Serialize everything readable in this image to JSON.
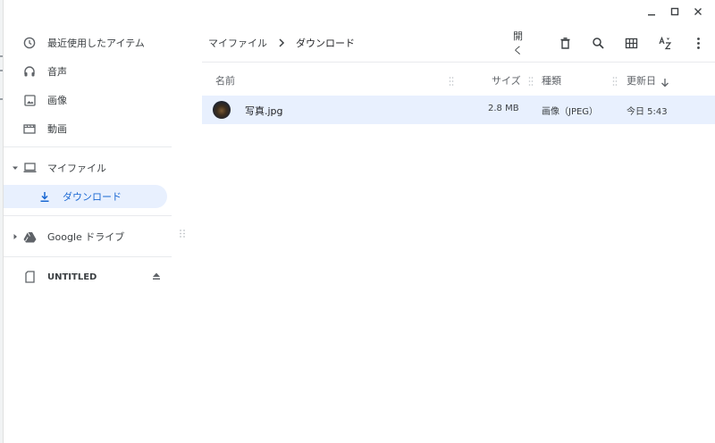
{
  "window": {
    "controls": [
      "minimize",
      "maximize",
      "close"
    ]
  },
  "sidebar": {
    "items": [
      {
        "label": "最近使用したアイテム",
        "icon": "clock-icon"
      },
      {
        "label": "音声",
        "icon": "headphones-icon"
      },
      {
        "label": "画像",
        "icon": "image-icon"
      },
      {
        "label": "動画",
        "icon": "video-icon"
      }
    ],
    "my_files": {
      "label": "マイファイル",
      "icon": "laptop-icon"
    },
    "downloads": {
      "label": "ダウンロード",
      "icon": "download-icon"
    },
    "google_drive": {
      "label": "Google ドライブ",
      "icon": "drive-icon"
    },
    "usb": {
      "label": "UNTITLED",
      "icon": "usb-icon"
    }
  },
  "breadcrumb": {
    "parent": "マイファイル",
    "current": "ダウンロード"
  },
  "toolbar": {
    "open_label": "開く",
    "icons": [
      "delete-icon",
      "search-icon",
      "grid-view-icon",
      "sort-az-icon",
      "more-icon"
    ]
  },
  "columns": {
    "name": "名前",
    "size": "サイズ",
    "type": "種類",
    "modified": "更新日"
  },
  "files": [
    {
      "name": "写真.jpg",
      "size": "2.8 MB",
      "type": "画像（JPEG）",
      "modified": "今日 5:43"
    }
  ],
  "colors": {
    "accent": "#1967d2",
    "selection": "#e8f0fe"
  }
}
